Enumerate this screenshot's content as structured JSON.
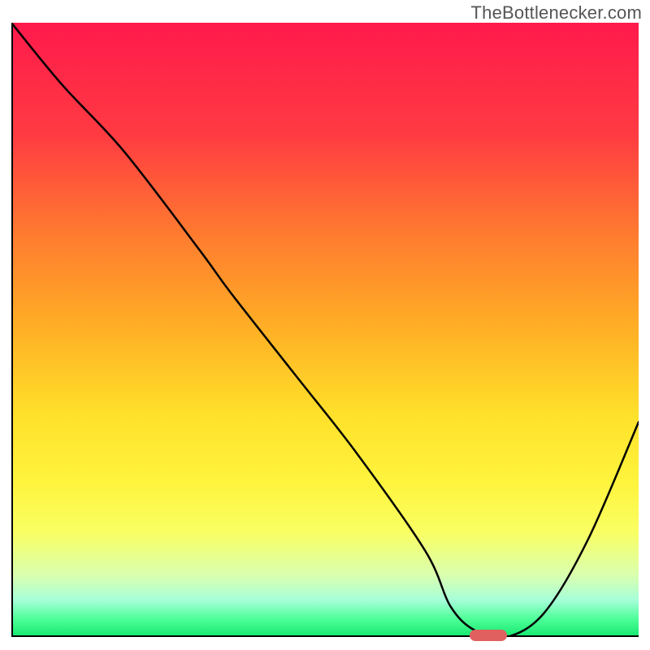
{
  "watermark": "TheBottlenecker.com",
  "colors": {
    "axis": "#000000",
    "curve": "#000000",
    "marker": "#e06060",
    "gradient_top": "#ff1a4c",
    "gradient_bottom": "#14e86f"
  },
  "chart_data": {
    "type": "line",
    "title": "",
    "xlabel": "",
    "ylabel": "",
    "xlim": [
      0,
      100
    ],
    "ylim": [
      0,
      100
    ],
    "x": [
      0,
      8,
      18,
      30,
      35,
      45,
      55,
      66,
      70,
      74,
      79,
      85,
      92,
      100
    ],
    "values": [
      100,
      90,
      79,
      63,
      56,
      43,
      30,
      14,
      5,
      1,
      0,
      4,
      16,
      35
    ],
    "marker_x": [
      73,
      79
    ],
    "marker_y": 0,
    "note": "Axes are unlabeled in the source image; values are in percent of plot area (0 = bottom/left, 100 = top/right) estimated visually."
  }
}
